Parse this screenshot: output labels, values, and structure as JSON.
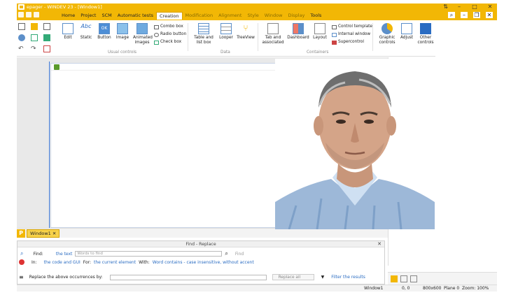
{
  "window": {
    "title": "epager - WINDEV 23 - [Window1]"
  },
  "menu": {
    "tabs": [
      "Home",
      "Project",
      "SCM",
      "Automatic tests",
      "Creation",
      "Modification",
      "Alignment",
      "Style",
      "Window",
      "Display",
      "Tools"
    ],
    "active": "Creation"
  },
  "ribbon": {
    "usual": {
      "label": "Usual controls",
      "buttons": [
        "Edit",
        "Static",
        "Button",
        "Image",
        "Animated images"
      ],
      "list": [
        "Combo box",
        "Radio button",
        "Check box"
      ]
    },
    "data": {
      "label": "Data",
      "buttons": [
        "Table and list box",
        "Looper",
        "TreeView"
      ]
    },
    "containers": {
      "label": "Containers",
      "buttons": [
        "Tab and associated",
        "Dashboard",
        "Layout"
      ],
      "list": [
        "Control template",
        "Internal window",
        "Supercontrol"
      ]
    },
    "other": {
      "buttons": [
        "Graphic controls",
        "Adjust",
        "Other controls"
      ]
    }
  },
  "doc_tab": {
    "label": "Window1"
  },
  "find": {
    "title": "Find - Replace",
    "find_label": "Find:",
    "find_scope": "the text",
    "find_placeholder": "Words to find",
    "find_button": "Find",
    "in_label": "In:",
    "in_value": "the code and GUI",
    "for_label": "For:",
    "for_value": "the current element",
    "with_label": "With:",
    "with_value": "Word contains - case insensitive, without accent",
    "replace_label": "Replace the above occurrences by:",
    "replace_all": "Replace all",
    "filter": "Filter the results"
  },
  "status": {
    "window": "Window1",
    "coords": "0, 0",
    "size": "800x600",
    "plane": "Plane 0",
    "zoom": "Zoom: 100%"
  },
  "colors": {
    "accent": "#f2b705",
    "link": "#2a6cc2"
  }
}
